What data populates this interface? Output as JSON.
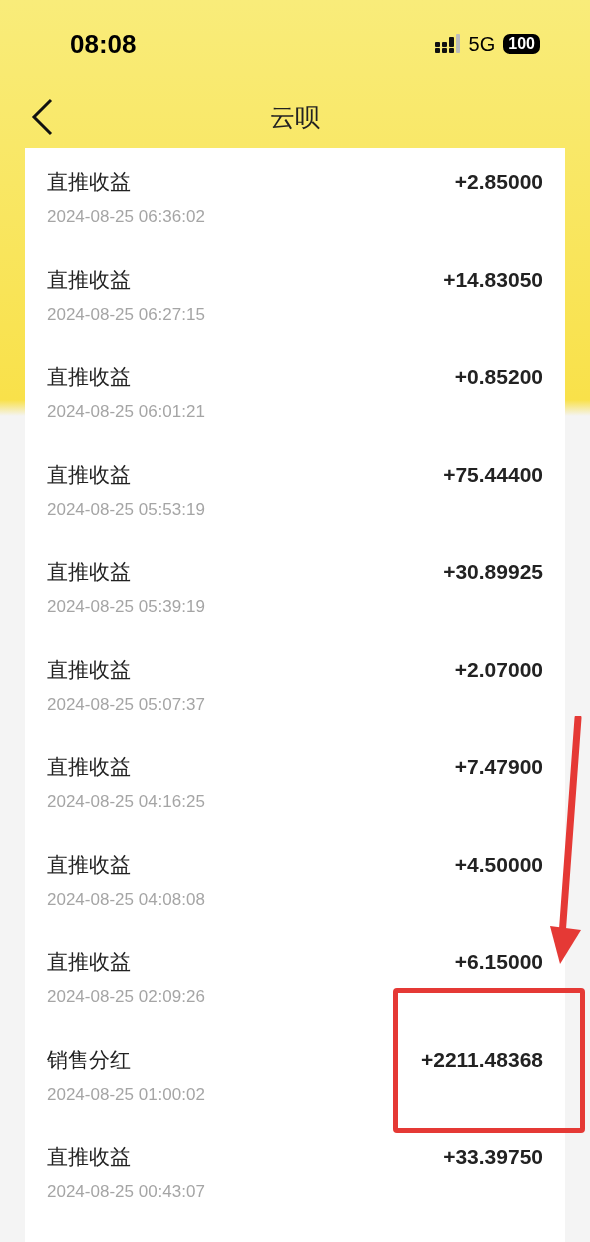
{
  "status_bar": {
    "time": "08:08",
    "network": "5G",
    "battery": "100"
  },
  "nav": {
    "title": "云呗"
  },
  "records": [
    {
      "title": "直推收益",
      "time": "2024-08-25 06:36:02",
      "amount": "+2.85000",
      "highlighted": false
    },
    {
      "title": "直推收益",
      "time": "2024-08-25 06:27:15",
      "amount": "+14.83050",
      "highlighted": false
    },
    {
      "title": "直推收益",
      "time": "2024-08-25 06:01:21",
      "amount": "+0.85200",
      "highlighted": false
    },
    {
      "title": "直推收益",
      "time": "2024-08-25 05:53:19",
      "amount": "+75.44400",
      "highlighted": false
    },
    {
      "title": "直推收益",
      "time": "2024-08-25 05:39:19",
      "amount": "+30.89925",
      "highlighted": false
    },
    {
      "title": "直推收益",
      "time": "2024-08-25 05:07:37",
      "amount": "+2.07000",
      "highlighted": false
    },
    {
      "title": "直推收益",
      "time": "2024-08-25 04:16:25",
      "amount": "+7.47900",
      "highlighted": false
    },
    {
      "title": "直推收益",
      "time": "2024-08-25 04:08:08",
      "amount": "+4.50000",
      "highlighted": false
    },
    {
      "title": "直推收益",
      "time": "2024-08-25 02:09:26",
      "amount": "+6.15000",
      "highlighted": false
    },
    {
      "title": "销售分红",
      "time": "2024-08-25 01:00:02",
      "amount": "+2211.48368",
      "highlighted": true
    },
    {
      "title": "直推收益",
      "time": "2024-08-25 00:43:07",
      "amount": "+33.39750",
      "highlighted": false
    }
  ]
}
